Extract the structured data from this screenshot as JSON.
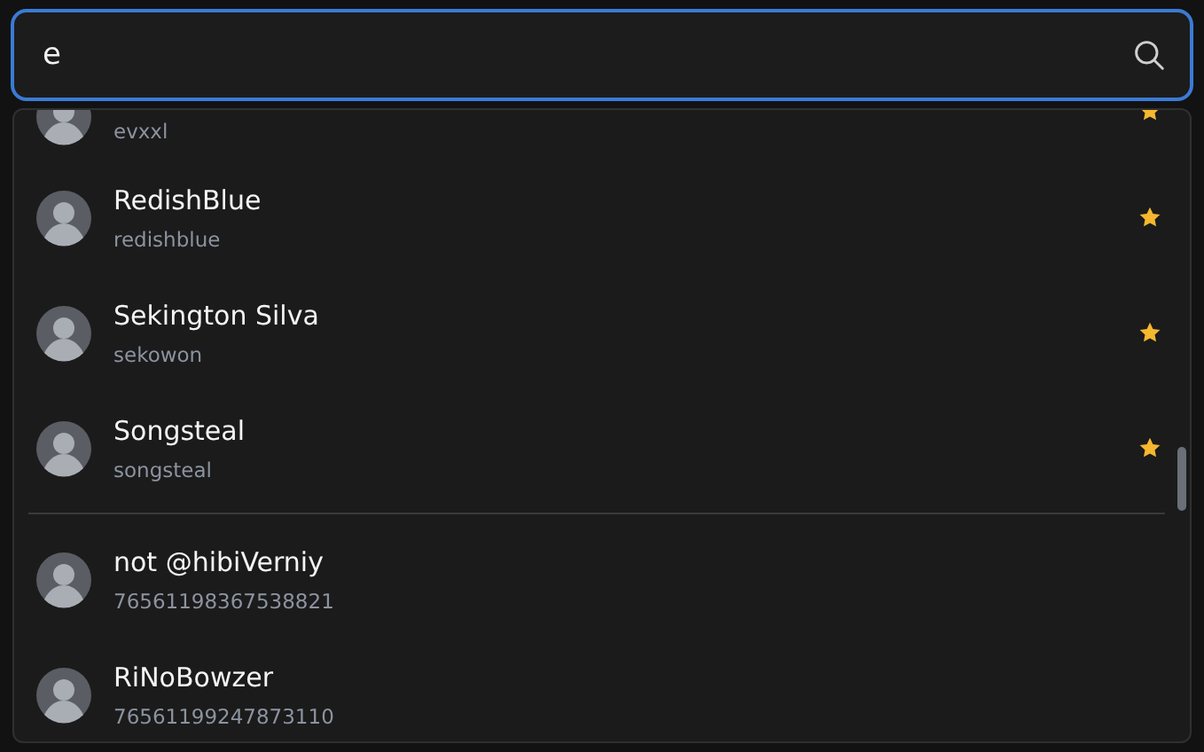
{
  "search": {
    "value": "e"
  },
  "groups": [
    {
      "items": [
        {
          "kind": "partial",
          "username": "evxxl",
          "favorite": true
        },
        {
          "kind": "full",
          "name": "RedishBlue",
          "username": "redishblue",
          "favorite": true
        },
        {
          "kind": "full",
          "name": "Sekington Silva",
          "username": "sekowon",
          "favorite": true
        },
        {
          "kind": "full",
          "name": "Songsteal",
          "username": "songsteal",
          "favorite": true
        }
      ]
    },
    {
      "items": [
        {
          "kind": "full",
          "name": "not @hibiVerniy",
          "username": "76561198367538821",
          "favorite": false
        },
        {
          "kind": "full",
          "name": "RiNoBowzer",
          "username": "76561199247873110",
          "favorite": false
        }
      ]
    }
  ]
}
